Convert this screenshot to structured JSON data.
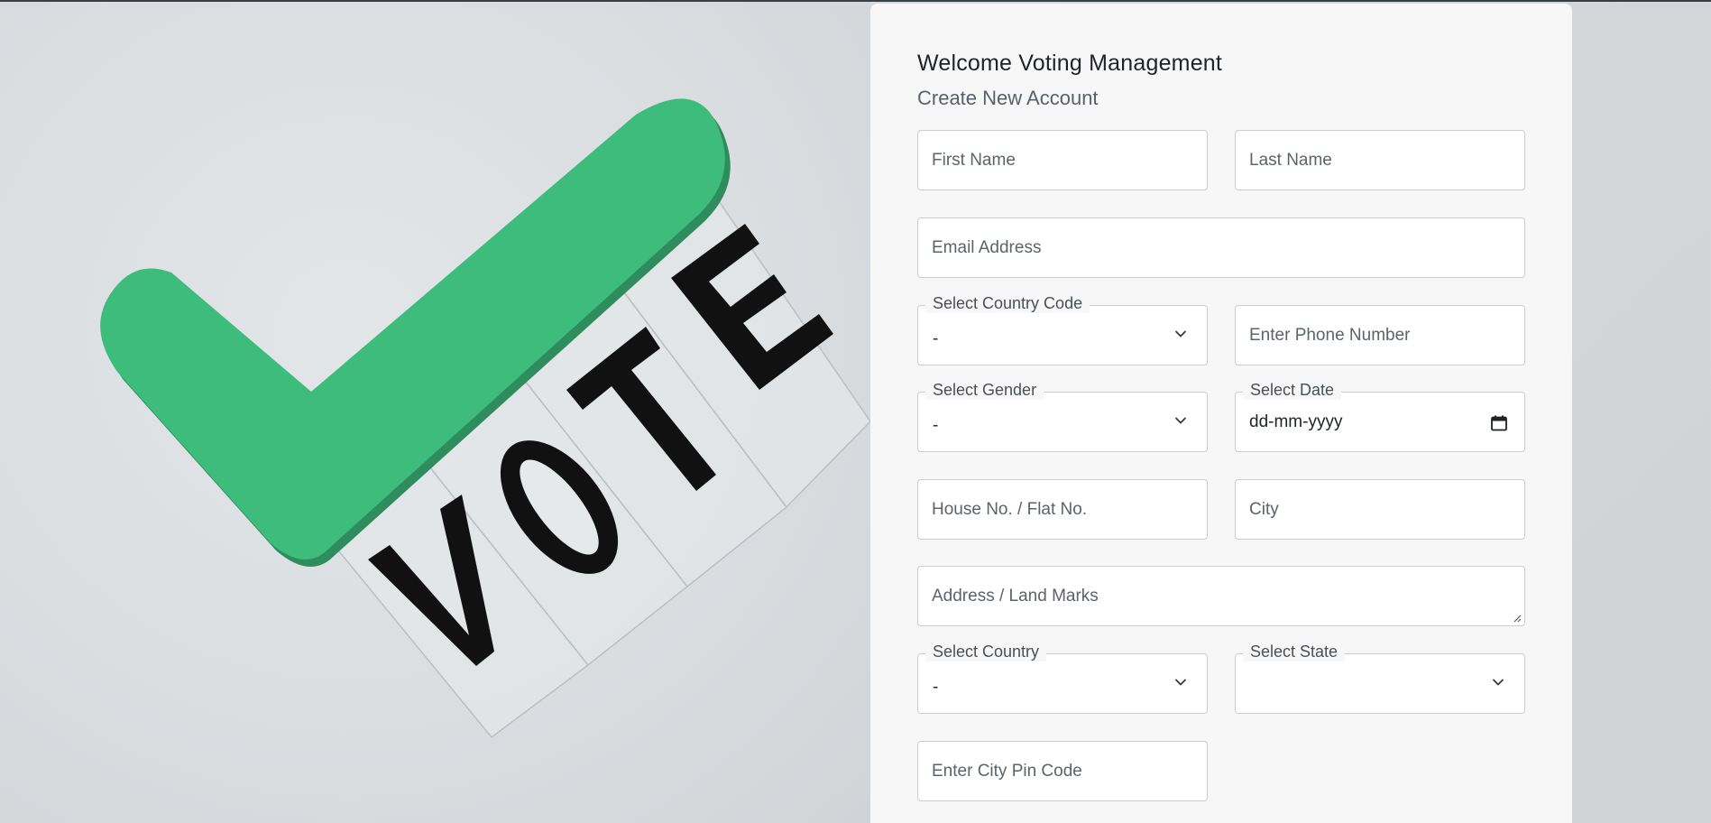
{
  "hero": {
    "image_text": "VOTE",
    "check_color": "#3dbc7c",
    "letter_color": "#111111"
  },
  "form": {
    "title": "Welcome Voting Management",
    "subtitle": "Create New Account",
    "first_name": {
      "placeholder": "First Name"
    },
    "last_name": {
      "placeholder": "Last Name"
    },
    "email": {
      "placeholder": "Email Address"
    },
    "country_code": {
      "label": "Select Country Code",
      "value": "-"
    },
    "phone": {
      "placeholder": "Enter Phone Number"
    },
    "gender": {
      "label": "Select Gender",
      "value": "-"
    },
    "date": {
      "label": "Select Date",
      "value": "dd-mm-yyyy"
    },
    "house": {
      "placeholder": "House No. / Flat No."
    },
    "city": {
      "placeholder": "City"
    },
    "address": {
      "placeholder": "Address / Land Marks"
    },
    "country": {
      "label": "Select Country",
      "value": "-"
    },
    "state": {
      "label": "Select State",
      "value": ""
    },
    "pin": {
      "placeholder": "Enter City Pin Code"
    }
  }
}
